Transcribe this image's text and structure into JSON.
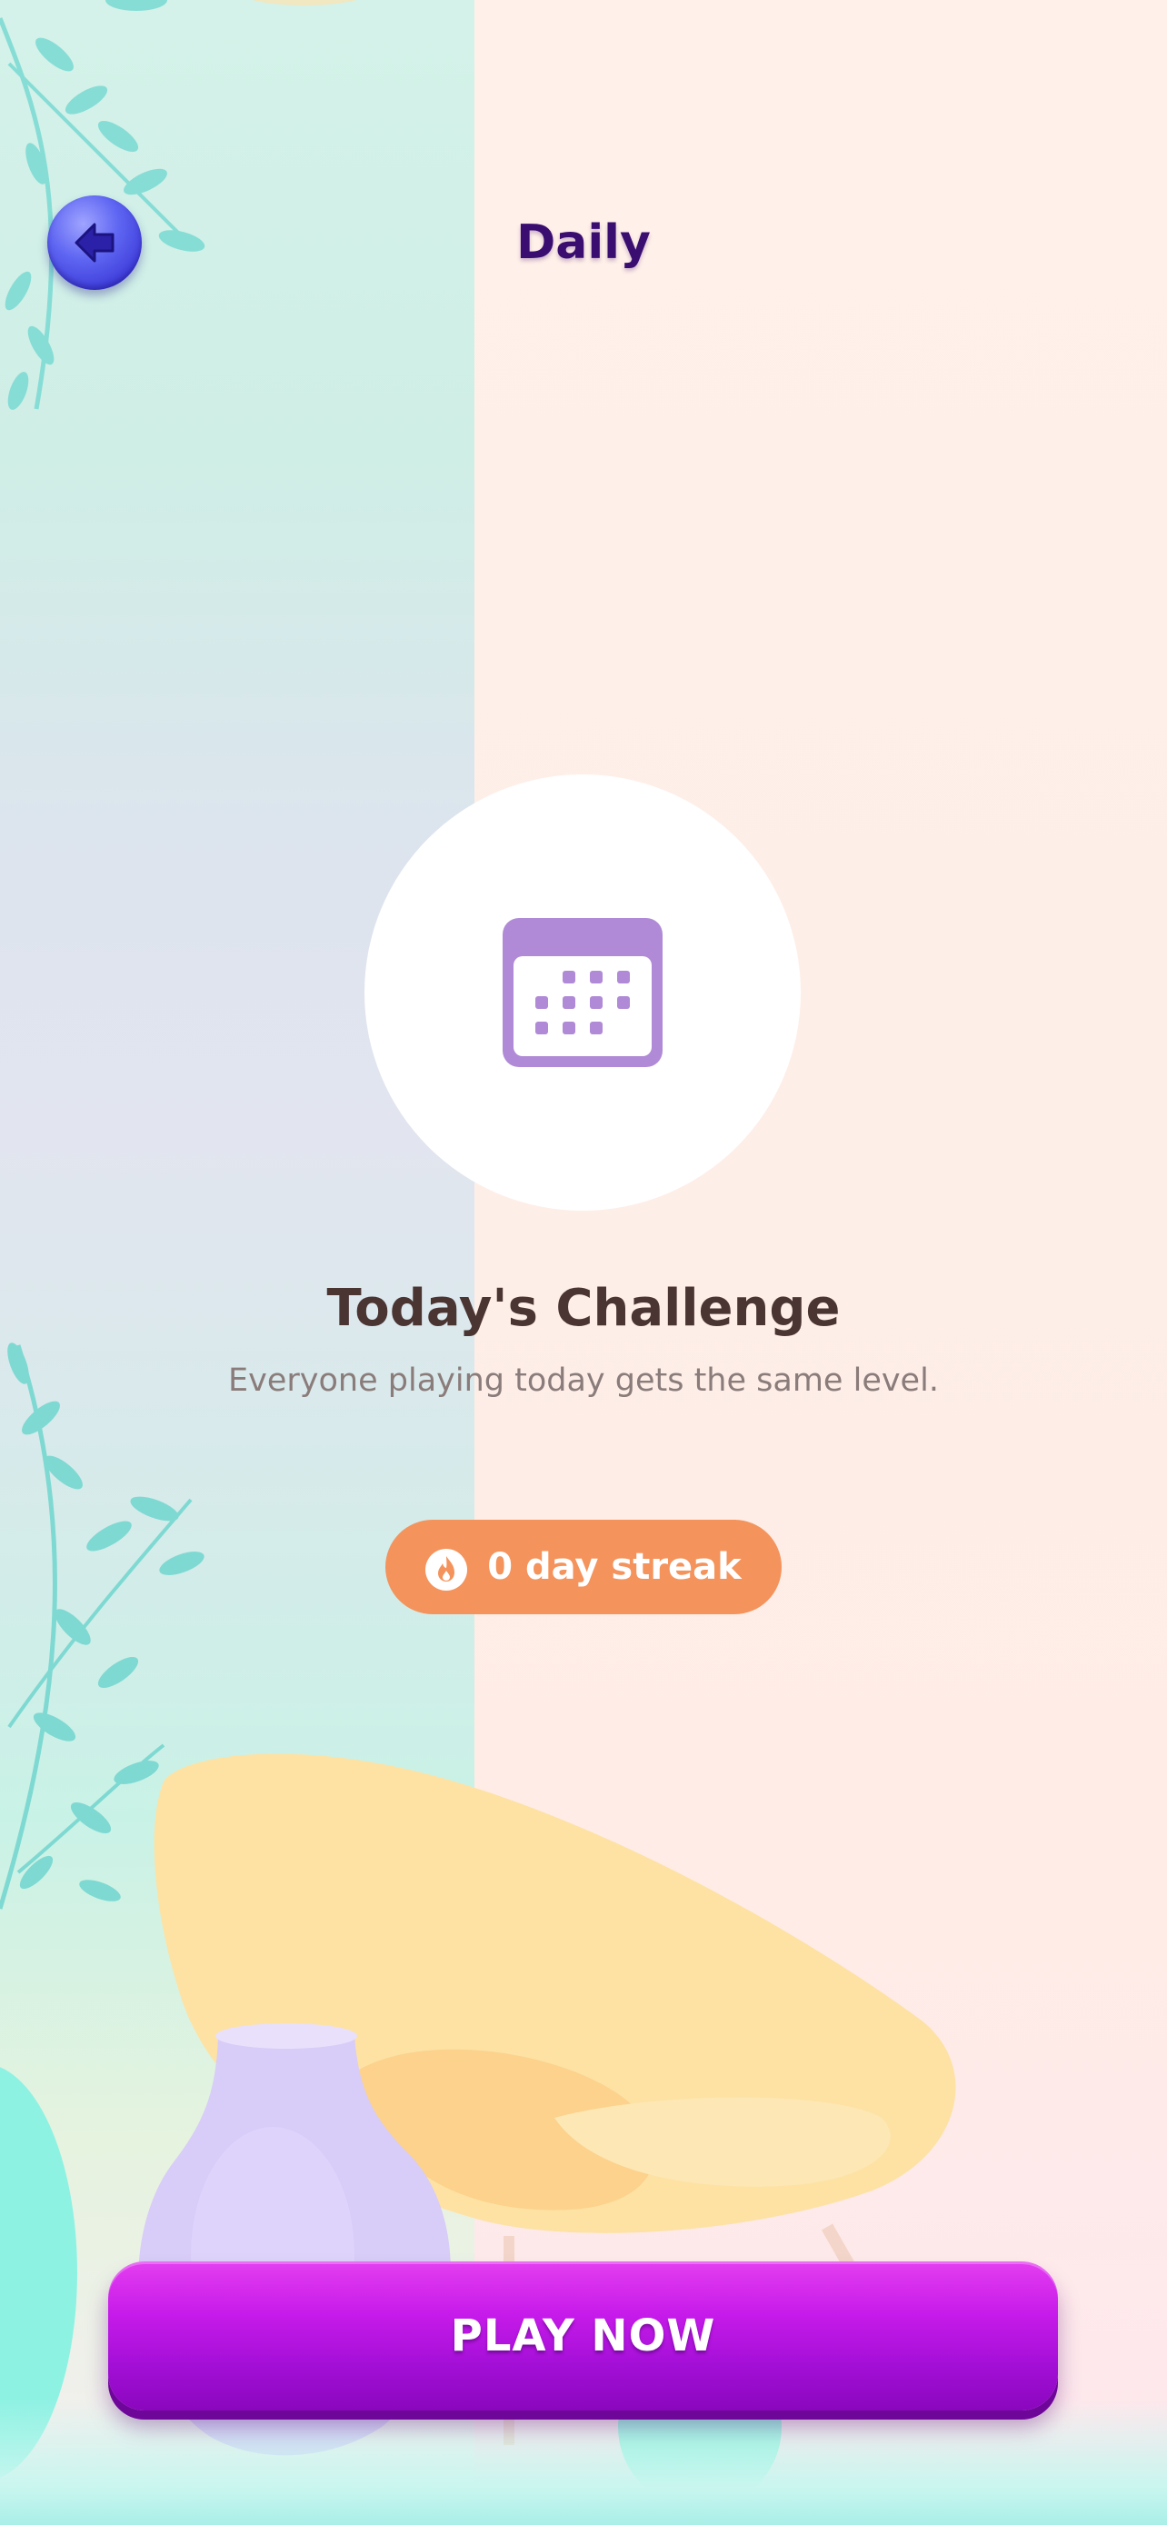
{
  "header": {
    "title": "Daily",
    "back_icon": "arrow-left-icon"
  },
  "challenge": {
    "icon": "calendar-icon",
    "title": "Today's Challenge",
    "subtitle": "Everyone playing today gets the same level."
  },
  "streak": {
    "icon": "flame-icon",
    "label": "0 day streak"
  },
  "play_button": {
    "label": "PLAY NOW"
  },
  "colors": {
    "title_purple": "#3a0d70",
    "back_button_blue": "#4a4be6",
    "calendar_lilac": "#b08ad6",
    "streak_orange": "#f4935c",
    "play_button_magenta": "#c71bea",
    "challenge_text": "#4a3533",
    "subtitle_text": "#8a7c7a"
  }
}
